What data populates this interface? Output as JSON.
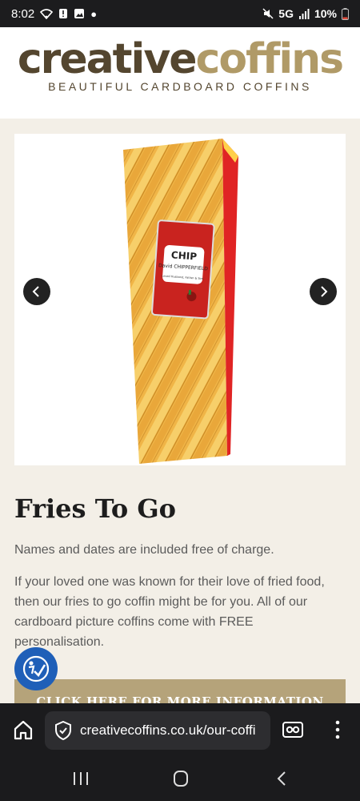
{
  "status_bar": {
    "time": "8:02",
    "network": "5G",
    "battery": "10%"
  },
  "header": {
    "logo_part1": "creative",
    "logo_part2": "coffins",
    "tagline": "BEAUTIFUL CARDBOARD COFFINS"
  },
  "product": {
    "title": "Fries To Go",
    "intro": "Names and dates are included free of charge.",
    "description": "If your loved one was known for their love of fried food, then our fries to go coffin might be for you. All of our cardboard picture coffins come with FREE personalisation.",
    "cta_label": "CLICK HERE FOR MORE INFORMATION",
    "image": {
      "packet_brand": "CHIP",
      "packet_name": "David\nCHIPPERFIELD",
      "packet_small": "Loved Husband, Father & Son"
    }
  },
  "browser": {
    "url": "creativecoffins.co.uk/our-coffi"
  },
  "colors": {
    "brand_dark": "#54462f",
    "brand_gold": "#b09a67",
    "cta": "#b5a37a",
    "a11y": "#1f5fb8"
  },
  "icons": [
    "wifi-icon",
    "alert-icon",
    "image-icon",
    "mute-icon",
    "signal-icon",
    "battery-icon",
    "chevron-left-icon",
    "chevron-right-icon",
    "accessibility-icon",
    "home-icon",
    "shield-icon",
    "tabs-icon",
    "more-icon",
    "recents-icon",
    "nav-home-icon",
    "back-icon"
  ]
}
